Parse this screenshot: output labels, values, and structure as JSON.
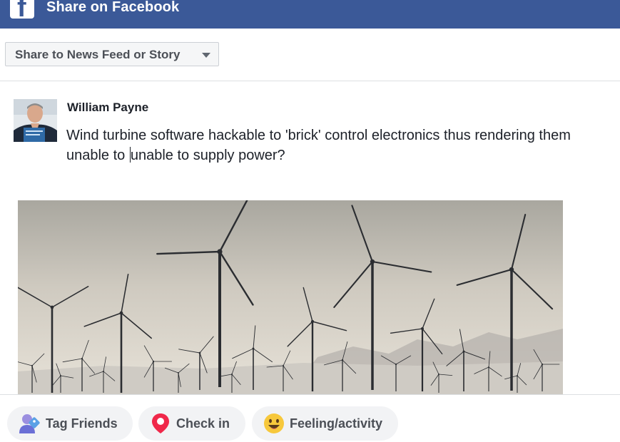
{
  "header": {
    "title": "Share on Facebook",
    "logo_icon": "facebook-f-icon",
    "background_color": "#3b5998"
  },
  "destination": {
    "selected": "Share to News Feed or Story",
    "icon": "chevron-down-icon"
  },
  "post": {
    "author": "William Payne",
    "text_before_cursor": "Wind turbine software hackable to 'brick' control electronics thus rendering them unable to ",
    "text_after_cursor": "unable to supply power?",
    "image": "wind-turbines-photo"
  },
  "actions": [
    {
      "label": "Tag Friends",
      "icon": "tag-friends-icon"
    },
    {
      "label": "Check in",
      "icon": "location-pin-icon"
    },
    {
      "label": "Feeling/activity",
      "icon": "smiley-icon"
    }
  ]
}
